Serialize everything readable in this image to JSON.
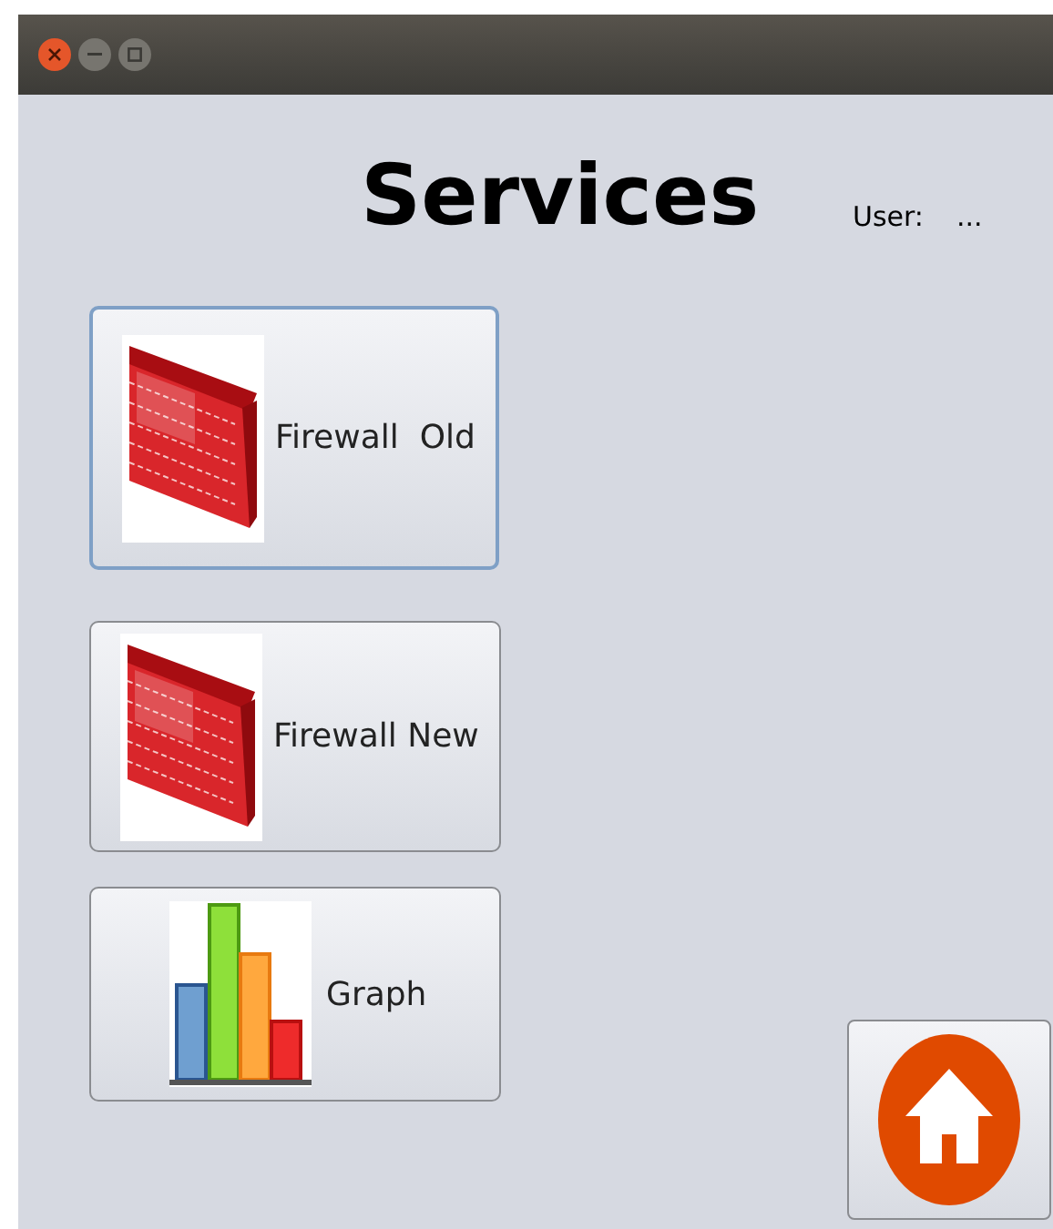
{
  "window": {
    "title_bar_buttons": [
      {
        "kind": "close"
      },
      {
        "kind": "minimize"
      },
      {
        "kind": "maximize"
      }
    ]
  },
  "heading": "Services",
  "user": {
    "label": "User:",
    "value": "..."
  },
  "services": [
    {
      "label": "Firewall  Old",
      "kind": "firewall",
      "focused": true
    },
    {
      "label": "Firewall New",
      "kind": "firewall",
      "focused": false
    },
    {
      "label": "Graph",
      "kind": "chart",
      "focused": false
    }
  ],
  "home_button": {
    "kind": "home"
  }
}
